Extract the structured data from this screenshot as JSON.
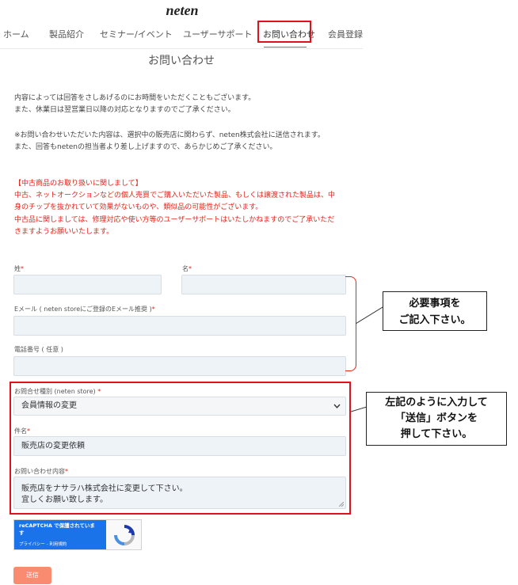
{
  "brand": {
    "logo_text": "neten"
  },
  "nav": {
    "items": [
      {
        "label": "ホーム"
      },
      {
        "label": "製品紹介"
      },
      {
        "label": "セミナー/イベント"
      },
      {
        "label": "ユーザーサポート"
      },
      {
        "label": "お問い合わせ"
      },
      {
        "label": "会員登録"
      }
    ],
    "active_index": 4
  },
  "page": {
    "title": "お問い合わせ"
  },
  "intro": {
    "lines": [
      "内容によっては回答をさしあげるのにお時間をいただくこともございます。",
      "また、休業日は翌営業日以降の対応となりますのでご了承ください。",
      "※お問い合わせいただいた内容は、選択中の販売店に関わらず、neten株式会社に送信されます。",
      "また、回答もnetenの担当者より差し上げますので、あらかじめご了承ください。"
    ]
  },
  "notice": {
    "heading": "【中古商品のお取り扱いに関しまして】",
    "lines": [
      "中古、ネットオークションなどの個人売買でご購入いただいた製品、もしくは譲渡された製品は、中",
      "身のチップを抜かれていて効果がないものや、類似品の可能性がございます。",
      "中古品に関しましては、修理対応や使い方等のユーザーサポートはいたしかねますのでご了承いただ",
      "きますようお願いいたします。"
    ]
  },
  "form": {
    "last_name_label": "姓",
    "first_name_label": "名",
    "required_mark": "*",
    "last_name_value": "",
    "first_name_value": "",
    "email_label": "Eメール ( neten storeにご登録のEメール推奨 )",
    "email_value": "",
    "phone_label": "電話番号 ( 任意 )",
    "phone_value": "",
    "category_label": "お問合せ種別 (neten store) ",
    "category_value": "会員情報の変更",
    "subject_label": "件名",
    "subject_value": "販売店の変更依頼",
    "message_label": "お問い合わせ内容",
    "message_line1": "販売店をナサラハ株式会社に変更して下さい。",
    "message_line2": "宜しくお願い致します。"
  },
  "callouts": {
    "required_line1": "必要事項を",
    "required_line2": "ご記入下さい。",
    "instruction_line1": "左記のように入力して",
    "instruction_line2": "「送信」ボタンを",
    "instruction_line3": "押して下さい。"
  },
  "captcha": {
    "title_line1": "reCAPTCHA で保護されていま",
    "title_line2": "す",
    "links": "プライバシー - 利用規約"
  },
  "submit": {
    "label": "送信"
  },
  "colors": {
    "accent_red": "#e0101c",
    "submit_bg": "#f98b70",
    "field_bg": "#eef3f8"
  }
}
